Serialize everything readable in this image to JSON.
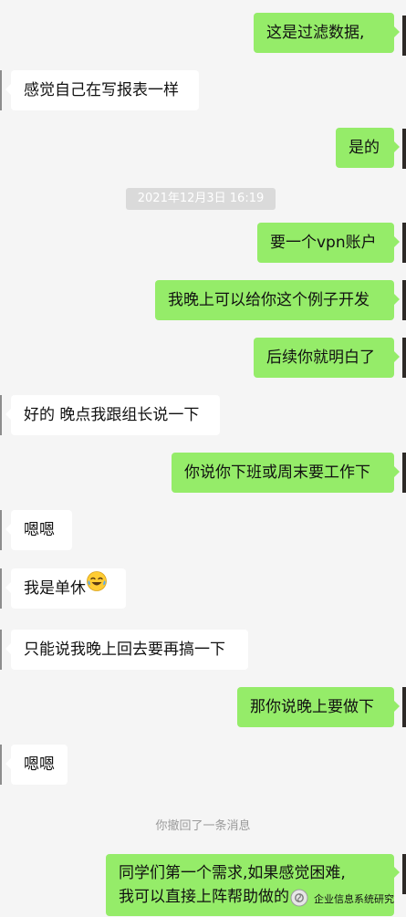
{
  "messages": [
    {
      "side": "out",
      "text": "这是过滤数据,"
    },
    {
      "side": "in",
      "text": "感觉自己在写报表一样"
    },
    {
      "side": "out",
      "text": "是的"
    },
    {
      "side": "out",
      "text": "要一个vpn账户"
    },
    {
      "side": "out",
      "text": "我晚上可以给你这个例子开发"
    },
    {
      "side": "out",
      "text": "后续你就明白了"
    },
    {
      "side": "in",
      "text": "好的 晚点我跟组长说一下"
    },
    {
      "side": "out",
      "text": "你说你下班或周末要工作下"
    },
    {
      "side": "in",
      "text": "嗯嗯"
    },
    {
      "side": "in",
      "text": "我是单休",
      "emoji": "laughing-crying-emoji"
    },
    {
      "side": "in",
      "text": "只能说我晚上回去要再搞一下"
    },
    {
      "side": "out",
      "text": "那你说晚上要做下"
    },
    {
      "side": "in",
      "text": "嗯嗯"
    },
    {
      "side": "out",
      "lines": [
        "同学们第一个需求,如果感觉困难,",
        "我可以直接上阵帮助做的"
      ]
    }
  ],
  "timestamp": "2021年12月3日 16:19",
  "recall_notice": "你撤回了一条消息",
  "watermark": {
    "text": "企业信息系统研究",
    "icon": "wechat-official-account-icon"
  },
  "colors": {
    "background": "#f5f5f5",
    "outgoing_bubble": "#95ec69",
    "incoming_bubble": "#ffffff",
    "timestamp_bg": "#dadada",
    "notice_text": "#9a9a9a"
  }
}
